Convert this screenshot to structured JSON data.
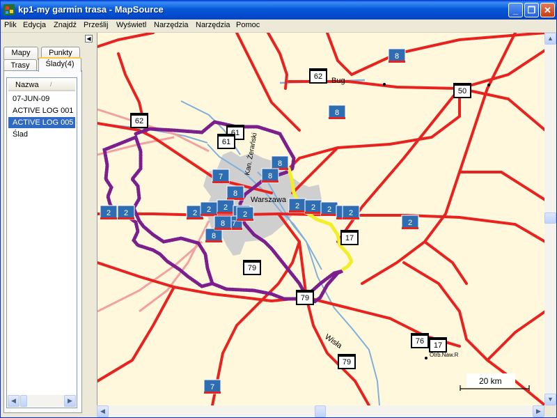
{
  "window": {
    "title": "kp1-my garmin trasa - MapSource"
  },
  "title_buttons": {
    "minimize": "_",
    "maximize": "❐",
    "close": "✕"
  },
  "menu": [
    "Plik",
    "Edycja",
    "Znajdź",
    "Prześlij",
    "Wyświetl",
    "Narzędzia",
    "Narzędzia",
    "Pomoc"
  ],
  "tabs": {
    "mapy": "Mapy",
    "punkty": "Punkty",
    "trasy": "Trasy",
    "slady": "Ślady(4)"
  },
  "list": {
    "column": "Nazwa",
    "sort_glyph": "/",
    "items": [
      "07-JUN-09",
      "ACTIVE LOG 001",
      "ACTIVE LOG 005",
      "Ślad"
    ],
    "selected_index": 2
  },
  "map": {
    "city_label": "Warszawa",
    "river_bug": "Bug",
    "river_wisla": "Wisła",
    "canal_label": "Kan. Żerański",
    "town_label": "Otrb.Naw.R",
    "scale_label": "20 km",
    "shields": {
      "s1": "8",
      "s2": "62",
      "s3": "50",
      "s4": "8",
      "s5": "62",
      "s6": "61",
      "s7": "61",
      "s8": "8",
      "s9": "7",
      "s10": "8",
      "s11": "8",
      "s12": "2",
      "s13": "2",
      "s14": "2",
      "s15": "2",
      "s16": "2",
      "s17": "2",
      "s18": "2",
      "s19": "8",
      "s20": "7",
      "s21": "8",
      "s22": "2",
      "s23": "2",
      "s24": "2",
      "s25": "2",
      "s26": "2",
      "s27": "2",
      "s28": "17",
      "s29": "79",
      "s30": "79",
      "s31": "76",
      "s32": "17",
      "s33": "79",
      "s34": "7"
    }
  },
  "colors": {
    "road": "#e8231f",
    "river": "#7fb0dc",
    "track_purple": "#7b1f8c",
    "track_yellow": "#f2ee2a",
    "urban": "#cfcfcf",
    "map_bg": "#fff8dc",
    "selection": "#316ac5"
  }
}
